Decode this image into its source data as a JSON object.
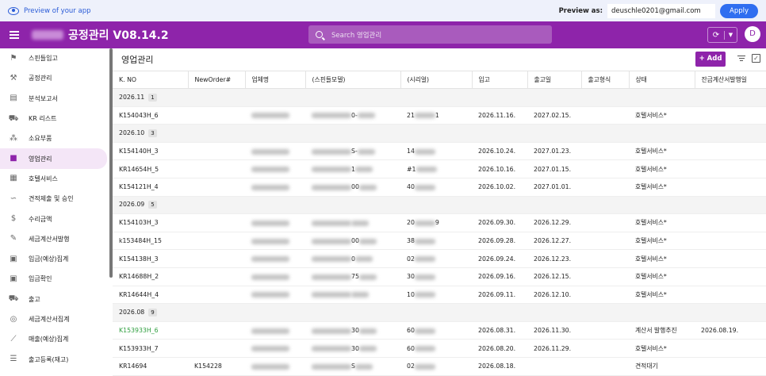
{
  "preview": {
    "link": "Preview of your app",
    "as_label": "Preview as:",
    "email": "deuschle0201@gmail.com",
    "apply": "Apply"
  },
  "appbar": {
    "title": "공정관리 V08.14.2",
    "search_placeholder": "Search 영업관리",
    "avatar": "D"
  },
  "sidebar": {
    "items": [
      {
        "label": "스핀들입고",
        "icon": "flag-icon",
        "glyph": "⚑"
      },
      {
        "label": "공정관리",
        "icon": "wrench-icon",
        "glyph": "⚒"
      },
      {
        "label": "분석보고서",
        "icon": "document-icon",
        "glyph": "▤"
      },
      {
        "label": "KR 리스트",
        "icon": "truck-icon",
        "glyph": "⛟"
      },
      {
        "label": "소요부품",
        "icon": "parts-icon",
        "glyph": "⁂"
      },
      {
        "label": "영업관리",
        "icon": "briefcase-icon",
        "glyph": "■",
        "active": true
      },
      {
        "label": "호텔서비스",
        "icon": "building-icon",
        "glyph": "▦"
      },
      {
        "label": "견적제출 및 승인",
        "icon": "handshake-icon",
        "glyph": "∽"
      },
      {
        "label": "수리금액",
        "icon": "dollar-icon",
        "glyph": "$"
      },
      {
        "label": "세금계산서발행",
        "icon": "edit-document-icon",
        "glyph": "✎"
      },
      {
        "label": "입금(예상)집계",
        "icon": "cash-icon",
        "glyph": "▣"
      },
      {
        "label": "입금확인",
        "icon": "cash-check-icon",
        "glyph": "▣"
      },
      {
        "label": "출고",
        "icon": "shipping-icon",
        "glyph": "⛟"
      },
      {
        "label": "세금계산서집계",
        "icon": "coin-icon",
        "glyph": "◎"
      },
      {
        "label": "매출(예상)집계",
        "icon": "trend-icon",
        "glyph": "⟋"
      },
      {
        "label": "출고등록(재고)",
        "icon": "list-icon",
        "glyph": "☰"
      }
    ]
  },
  "main": {
    "title": "영업관리",
    "add_label": "+ Add",
    "columns": [
      "K. NO",
      "NewOrder#",
      "업체명",
      "(스핀들모델)",
      "(시리얼)",
      "입고",
      "출고일",
      "출고형식",
      "상태",
      "잔금계산서발행일"
    ],
    "groups": [
      {
        "label": "2026.11",
        "count": "1",
        "rows": [
          {
            "kno": "K154043H_6",
            "neworder": "",
            "serial": "21",
            "serial_end": "1",
            "model_mid": "0-",
            "in": "2026.11.16.",
            "out": "2027.02.15.",
            "type": "",
            "status": "호텔서비스*",
            "date": ""
          }
        ]
      },
      {
        "label": "2026.10",
        "count": "3",
        "rows": [
          {
            "kno": "K154140H_3",
            "neworder": "",
            "serial": "14",
            "serial_end": "",
            "model_mid": "S-",
            "in": "2026.10.24.",
            "out": "2027.01.23.",
            "type": "",
            "status": "호텔서비스*",
            "date": ""
          },
          {
            "kno": "KR14654H_5",
            "neworder": "",
            "serial": "#1",
            "serial_end": "",
            "model_mid": "1",
            "in": "2026.10.16.",
            "out": "2027.01.15.",
            "type": "",
            "status": "호텔서비스*",
            "date": ""
          },
          {
            "kno": "K154121H_4",
            "neworder": "",
            "serial": "40",
            "serial_end": "",
            "model_mid": "00",
            "in": "2026.10.02.",
            "out": "2027.01.01.",
            "type": "",
            "status": "호텔서비스*",
            "date": ""
          }
        ]
      },
      {
        "label": "2026.09",
        "count": "5",
        "rows": [
          {
            "kno": "K154103H_3",
            "neworder": "",
            "serial": "20",
            "serial_end": "9",
            "model_mid": "",
            "in": "2026.09.30.",
            "out": "2026.12.29.",
            "type": "",
            "status": "호텔서비스*",
            "date": ""
          },
          {
            "kno": "k153484H_15",
            "neworder": "",
            "serial": "38",
            "serial_end": "",
            "model_mid": "00",
            "in": "2026.09.28.",
            "out": "2026.12.27.",
            "type": "",
            "status": "호텔서비스*",
            "date": ""
          },
          {
            "kno": "K154138H_3",
            "neworder": "",
            "serial": "02",
            "serial_end": "",
            "model_mid": "0",
            "in": "2026.09.24.",
            "out": "2026.12.23.",
            "type": "",
            "status": "호텔서비스*",
            "date": ""
          },
          {
            "kno": "KR14688H_2",
            "neworder": "",
            "serial": "30",
            "serial_end": "",
            "model_mid": "75",
            "in": "2026.09.16.",
            "out": "2026.12.15.",
            "type": "",
            "status": "호텔서비스*",
            "date": ""
          },
          {
            "kno": "KR14644H_4",
            "neworder": "",
            "serial": "10",
            "serial_end": "",
            "model_mid": "",
            "in": "2026.09.11.",
            "out": "2026.12.10.",
            "type": "",
            "status": "호텔서비스*",
            "date": ""
          }
        ]
      },
      {
        "label": "2026.08",
        "count": "9",
        "rows": [
          {
            "kno": "K153933H_6",
            "neworder": "",
            "serial": "60",
            "serial_end": "",
            "model_mid": "30",
            "in": "2026.08.31.",
            "out": "2026.11.30.",
            "type": "",
            "status": "계산서 발행추진",
            "date": "2026.08.19.",
            "highlight": true
          },
          {
            "kno": "K153933H_7",
            "neworder": "",
            "serial": "60",
            "serial_end": "",
            "model_mid": "30",
            "in": "2026.08.20.",
            "out": "2026.11.29.",
            "type": "",
            "status": "호텔서비스*",
            "date": ""
          },
          {
            "kno": "KR14694",
            "neworder": "K154228",
            "serial": "02",
            "serial_end": "",
            "model_mid": "S",
            "in": "2026.08.18.",
            "out": "",
            "type": "",
            "status": "견적대기",
            "date": ""
          }
        ]
      }
    ]
  }
}
